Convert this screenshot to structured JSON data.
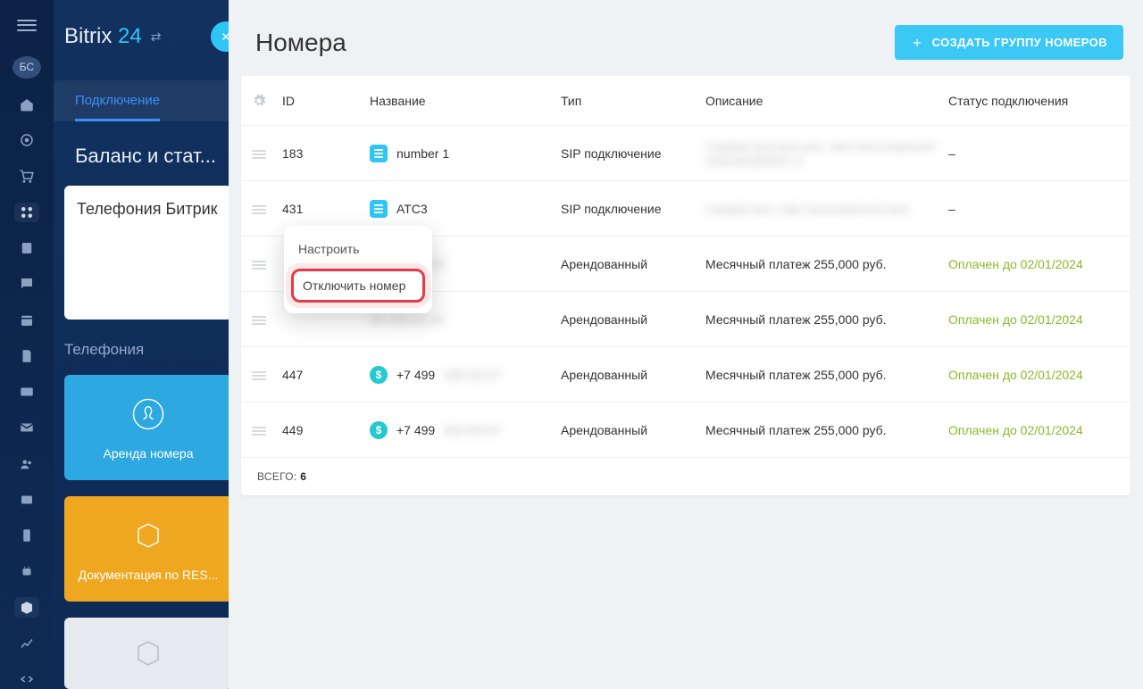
{
  "brand": {
    "part1": "Bitrix",
    "part2": "24"
  },
  "avatar": "БС",
  "sec": {
    "tab": "Подключение",
    "title": "Баланс и стат...",
    "card_title": "Телефония Битрик",
    "section_label": "Телефония",
    "tool1": "Аренда номера",
    "tool2": "Документация по RES..."
  },
  "main": {
    "title": "Номера",
    "create_btn": "СОЗДАТЬ ГРУППУ НОМЕРОВ",
    "headers": {
      "id": "ID",
      "name": "Название",
      "type": "Тип",
      "desc": "Описание",
      "status": "Статус подключения"
    },
    "rows": [
      {
        "id": "183",
        "name": "number 1",
        "icon": "sip",
        "type": "SIP подключение",
        "desc": "Сервер test.test.com, имя пользователя testuser@bitrix.ru",
        "descBlur": true,
        "status": "–",
        "statusClass": ""
      },
      {
        "id": "431",
        "name": "АТС3",
        "icon": "sip",
        "type": "SIP подключение",
        "desc": "Сервер test, имя пользователя test",
        "descBlur": true,
        "status": "–",
        "statusClass": ""
      },
      {
        "id": "",
        "name": "99  838-81-38",
        "nameBlur": true,
        "icon": "",
        "type": "Арендованный",
        "desc": "Месячный платеж 255,000 руб.",
        "status": "Оплачен до 02/01/2024",
        "statusClass": "status-paid"
      },
      {
        "id": "",
        "name": "99  533-31-38",
        "nameBlur": true,
        "icon": "",
        "type": "Арендованный",
        "desc": "Месячный платеж 255,000 руб.",
        "status": "Оплачен до 02/01/2024",
        "statusClass": "status-paid"
      },
      {
        "id": "447",
        "name": "+7 499",
        "nameTail": "838-83-87",
        "nameTailBlur": true,
        "icon": "dollar",
        "type": "Арендованный",
        "desc": "Месячный платеж 255,000 руб.",
        "status": "Оплачен до 02/01/2024",
        "statusClass": "status-paid"
      },
      {
        "id": "449",
        "name": "+7 499",
        "nameTail": "983-88-87",
        "nameTailBlur": true,
        "icon": "dollar",
        "type": "Арендованный",
        "desc": "Месячный платеж 255,000 руб.",
        "status": "Оплачен до 02/01/2024",
        "statusClass": "status-paid"
      }
    ],
    "footer_label": "ВСЕГО: ",
    "footer_count": "6"
  },
  "popup": {
    "configure": "Настроить",
    "disable": "Отключить номер"
  }
}
